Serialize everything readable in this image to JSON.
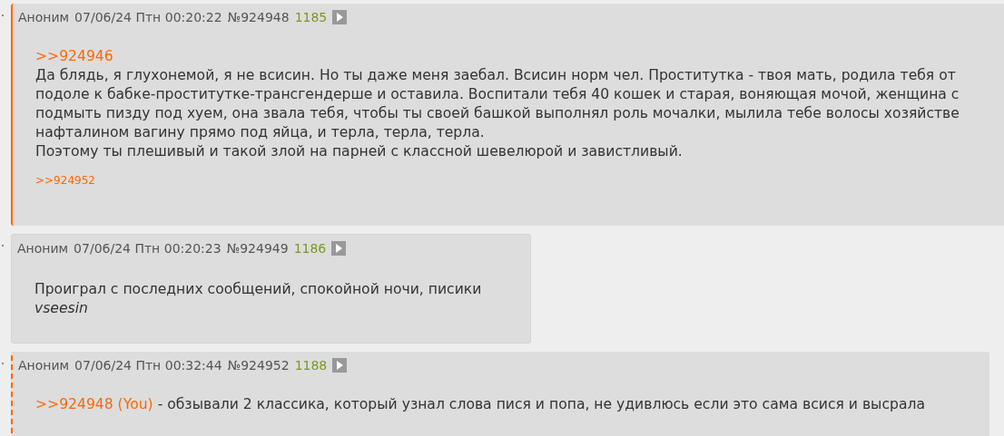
{
  "posts": [
    {
      "kind": "own",
      "name": "Аноним",
      "date": "07/06/24 Птн 00:20:22",
      "number": "№924948",
      "count": "1185",
      "body": [
        {
          "kind": "quote",
          "quote": ">>924946"
        },
        {
          "kind": "text",
          "text": "Да блядь, я глухонемой, я не всисин. Но ты даже меня заебал. Всисин норм чел. Проститутка - твоя мать, родила тебя от"
        },
        {
          "kind": "text",
          "text": "подоле к бабке-проститутке-трансгендерше и оставила. Воспитали тебя 40 кошек и старая, воняющая мочой, женщина с"
        },
        {
          "kind": "text",
          "text": "подмыть пизду под хуем, она звала тебя, чтобы ты своей башкой выполнял роль мочалки, мылила тебе волосы хозяйстве"
        },
        {
          "kind": "text",
          "text": "нафталином вагину прямо под яйца, и терла, терла, терла."
        },
        {
          "kind": "text",
          "text": "Поэтому ты плешивый и такой злой на парней с классной шевелюрой и завистливый."
        }
      ],
      "replies": [
        ">>924952"
      ]
    },
    {
      "kind": "plain",
      "name": "Аноним",
      "date": "07/06/24 Птн 00:20:23",
      "number": "№924949",
      "count": "1186",
      "body": [
        {
          "kind": "text",
          "text": "Проиграл с последних сообщений, спокойной ночи, писики"
        },
        {
          "kind": "italic",
          "text": "vseesin"
        }
      ]
    },
    {
      "kind": "reply_to_you",
      "name": "Аноним",
      "date": "07/06/24 Птн 00:32:44",
      "number": "№924952",
      "count": "1188",
      "body": [
        {
          "kind": "quote_text",
          "quote": ">>924948 (You)",
          "text": " - обзывали 2 классика, который узнал слова пися и попа, не удивлюсь если это сама всися и высрала"
        }
      ]
    }
  ]
}
